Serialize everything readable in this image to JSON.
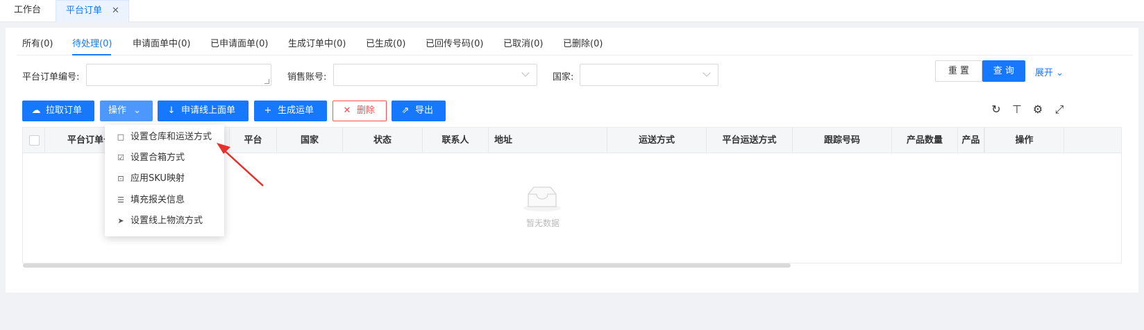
{
  "tabs": {
    "workbench": "工作台",
    "active": "平台订单",
    "close": "✕"
  },
  "subtabs": [
    "所有(0)",
    "待处理(0)",
    "申请面单中(0)",
    "已申请面单(0)",
    "生成订单中(0)",
    "已生成(0)",
    "已回传号码(0)",
    "已取消(0)",
    "已删除(0)"
  ],
  "active_subtab": "待处理(0)",
  "filters": {
    "order_no_label": "平台订单编号:",
    "sales_account_label": "销售账号:",
    "country_label": "国家:"
  },
  "buttons": {
    "reset": "重 置",
    "query": "查 询",
    "expand": "展开"
  },
  "actions": {
    "pull_orders": "拉取订单",
    "operate": "操作",
    "apply_waybill": "申请线上面单",
    "generate_waybill": "生成运单",
    "delete": "删除",
    "export": "导出"
  },
  "columns": [
    "平台订单号",
    "平台",
    "国家",
    "状态",
    "联系人",
    "地址",
    "运送方式",
    "平台运送方式",
    "跟踪号码",
    "产品数量",
    "产品",
    "操作"
  ],
  "empty_text": "暂无数据",
  "dropdown": [
    {
      "label": "设置仓库和运送方式",
      "icon": "warehouse-icon"
    },
    {
      "label": "设置合箱方式",
      "icon": "box-icon"
    },
    {
      "label": "应用SKU映射",
      "icon": "sku-icon"
    },
    {
      "label": "填充报关信息",
      "icon": "list-icon"
    },
    {
      "label": "设置线上物流方式",
      "icon": "send-icon"
    }
  ],
  "colors": {
    "primary": "#1677ff",
    "danger": "#ff4d4f",
    "annotation": "#e8302a"
  }
}
